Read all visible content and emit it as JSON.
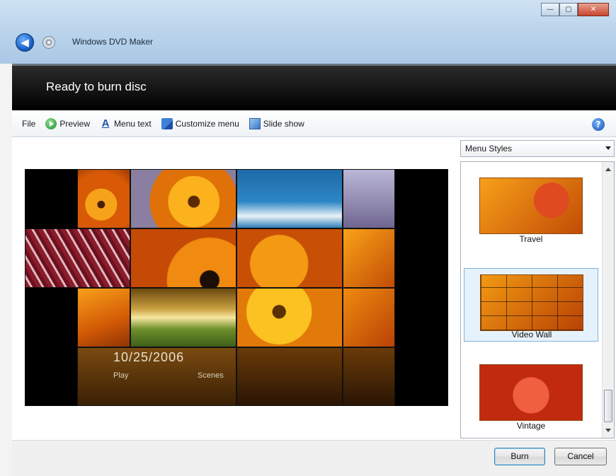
{
  "window": {
    "title": "Windows DVD Maker",
    "caption_buttons": {
      "minimize": "—",
      "maximize": "▢",
      "close": "✕"
    }
  },
  "header": {
    "title": "Ready to burn disc"
  },
  "toolbar": {
    "file": "File",
    "preview": "Preview",
    "menu_text": "Menu text",
    "customize_menu": "Customize menu",
    "slide_show": "Slide show",
    "help": "?"
  },
  "menu_preview": {
    "date": "10/25/2006",
    "play": "Play",
    "scenes": "Scenes"
  },
  "styles_panel": {
    "select_value": "Menu Styles",
    "items": [
      {
        "label": "Travel",
        "selected": false
      },
      {
        "label": "Video Wall",
        "selected": true
      },
      {
        "label": "Vintage",
        "selected": false
      }
    ]
  },
  "footer": {
    "burn": "Burn",
    "cancel": "Cancel"
  },
  "colors": {
    "header_bg": "#000000",
    "accent_blue": "#1d4fa8",
    "flower_orange": "#f08a10"
  }
}
